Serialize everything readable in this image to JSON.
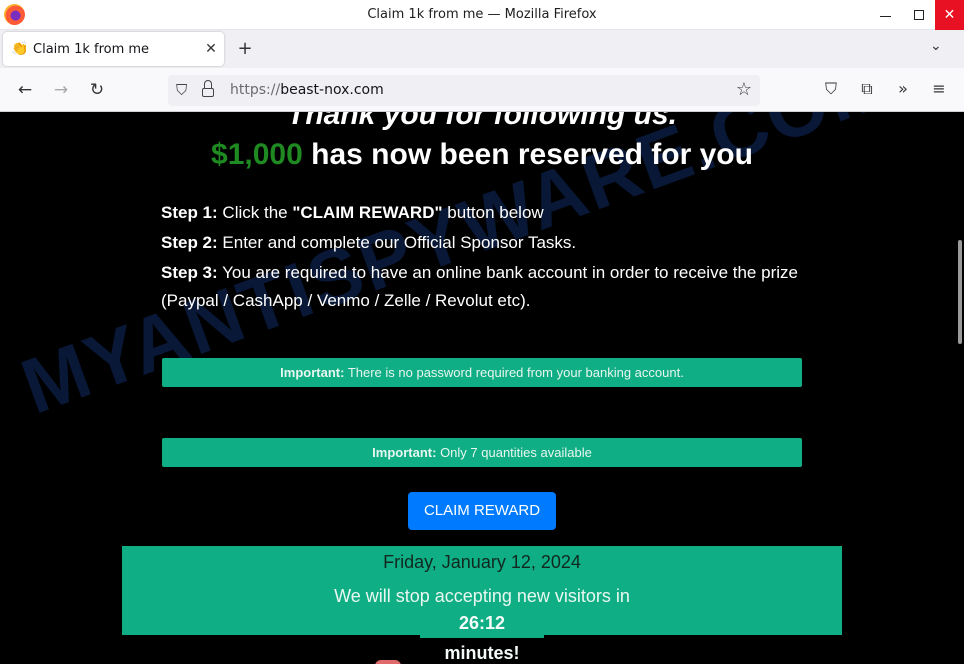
{
  "window": {
    "title": "Claim 1k from me — Mozilla Firefox",
    "controls": {
      "minimize": "minimize",
      "maximize": "maximize",
      "close": "✕"
    }
  },
  "tabs": [
    {
      "favicon": "👏",
      "label": "Claim 1k from me",
      "close": "✕",
      "active": true
    }
  ],
  "tabstrip": {
    "new_tab": "+",
    "list_all_tabs": "⌄"
  },
  "navbar": {
    "back": "←",
    "forward": "→",
    "reload": "↻",
    "url_scheme": "https://",
    "url_host": "beast-nox.com",
    "shield_icon": "⛉",
    "bookmark_icon": "☆",
    "pocket_icon": "⛉",
    "extensions_icon": "⧉",
    "overflow_icon": "»",
    "menu_icon": "≡"
  },
  "page": {
    "watermark": "MYANTISPYWARE.COM",
    "thank_you": "Thank you for following us.",
    "reserved": {
      "amount": "$1,000",
      "text": " has now been reserved for you",
      "amount_color": "#1e8a21"
    },
    "steps": [
      {
        "label": "Step 1:",
        "pre": " Click the ",
        "bold": "\"CLAIM REWARD\"",
        "post": " button below"
      },
      {
        "label": "Step 2:",
        "text": " Enter and complete our Official Sponsor Tasks."
      },
      {
        "label": "Step 3:",
        "text": " You are required to have an online bank account in order to receive the prize",
        "text2": "(Paypal / CashApp / Venmo / Zelle / Revolut etc)."
      }
    ],
    "alerts": [
      {
        "label": "Important:",
        "text": " There is no password required from your banking account."
      },
      {
        "label": "Important:",
        "text": " Only 7 quantities available"
      }
    ],
    "claim_button": "CLAIM REWARD",
    "countdown": {
      "date": "Friday, January 12, 2024",
      "message": "We will stop accepting new visitors in",
      "timer": "26:12 minutes!"
    },
    "colors": {
      "alert_bg": "#10ae84",
      "button_bg": "#007bff",
      "page_bg": "#000000"
    }
  }
}
